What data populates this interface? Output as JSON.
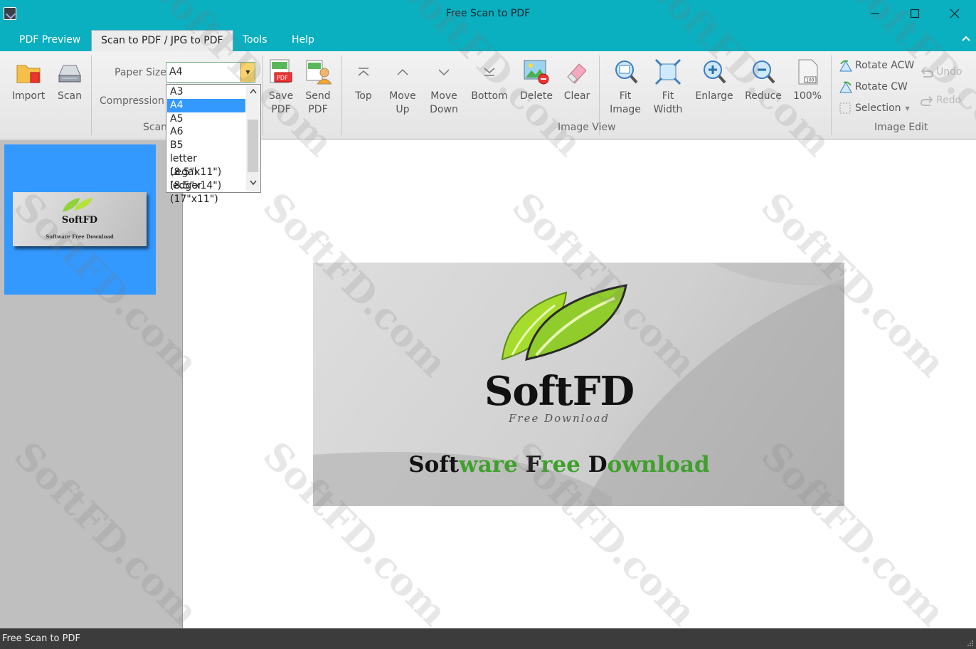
{
  "window": {
    "title": "Free Scan to PDF"
  },
  "menu": {
    "tabs": [
      {
        "label": "PDF Preview"
      },
      {
        "label": "Scan to PDF / JPG to PDF"
      },
      {
        "label": "Tools"
      },
      {
        "label": "Help"
      }
    ]
  },
  "ribbon": {
    "import_label": "Import",
    "scan_label": "Scan",
    "paper_size_label": "Paper Size",
    "paper_size_value": "A4",
    "compression_label": "Compression",
    "scan_group": "Scan",
    "save_pdf": [
      "Save",
      "PDF"
    ],
    "send_pdf": [
      "Send",
      "PDF"
    ],
    "top": "Top",
    "move_up": [
      "Move",
      "Up"
    ],
    "move_down": [
      "Move",
      "Down"
    ],
    "bottom": "Bottom",
    "delete": "Delete",
    "clear": "Clear",
    "fit_image": [
      "Fit",
      "Image"
    ],
    "fit_width": [
      "Fit",
      "Width"
    ],
    "enlarge": "Enlarge",
    "reduce": "Reduce",
    "zoom_100": "100%",
    "image_view_group": "Image View",
    "rotate_acw": "Rotate ACW",
    "rotate_cw": "Rotate CW",
    "selection": "Selection",
    "undo": "Undo",
    "redo": "Redo",
    "image_edit_group": "Image Edit"
  },
  "paper_size_options": [
    "A3",
    "A4",
    "A5",
    "A6",
    "B5",
    "letter (8.5\"x11\")",
    "Legal (8.5\"x14\")",
    "ledger (17\"x11\")"
  ],
  "paper_size_selected_index": 1,
  "thumbnail": {
    "logo": "SoftFD",
    "tagline": "Software Free Download"
  },
  "preview": {
    "logo": "SoftFD",
    "sublogo": "Free Download",
    "tagline_parts": [
      "Soft",
      "ware ",
      "F",
      "ree ",
      "D",
      "ownload"
    ]
  },
  "status": {
    "text": "Free Scan to PDF"
  },
  "watermark": "SoftFD.com",
  "colors": {
    "title_bar": "#0aafc0",
    "selection": "#3399ff",
    "green": "#3fa02c"
  }
}
